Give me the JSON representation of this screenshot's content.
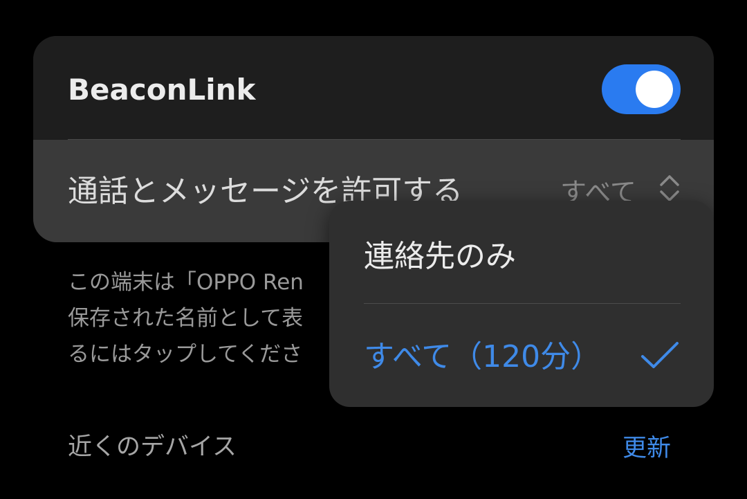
{
  "beacon": {
    "title": "BeaconLink",
    "toggle_state": "on"
  },
  "allow_row": {
    "label": "通話とメッセージを許可する",
    "value": "すべて"
  },
  "description": {
    "lines": [
      "この端末は「OPPO Ren",
      "保存された名前として表",
      "るにはタップしてくださ"
    ]
  },
  "nearby": {
    "title": "近くのデバイス",
    "refresh_label": "更新"
  },
  "menu": {
    "items": [
      {
        "label": "連絡先のみ",
        "selected": false
      },
      {
        "label": "すべて（120分）",
        "selected": true
      }
    ]
  },
  "colors": {
    "accent": "#2a7bf0",
    "link": "#3f8ae8",
    "background": "#000000"
  },
  "icons": {
    "value_chevron": "chevron-up-down-icon",
    "selected_mark": "checkmark-icon"
  }
}
